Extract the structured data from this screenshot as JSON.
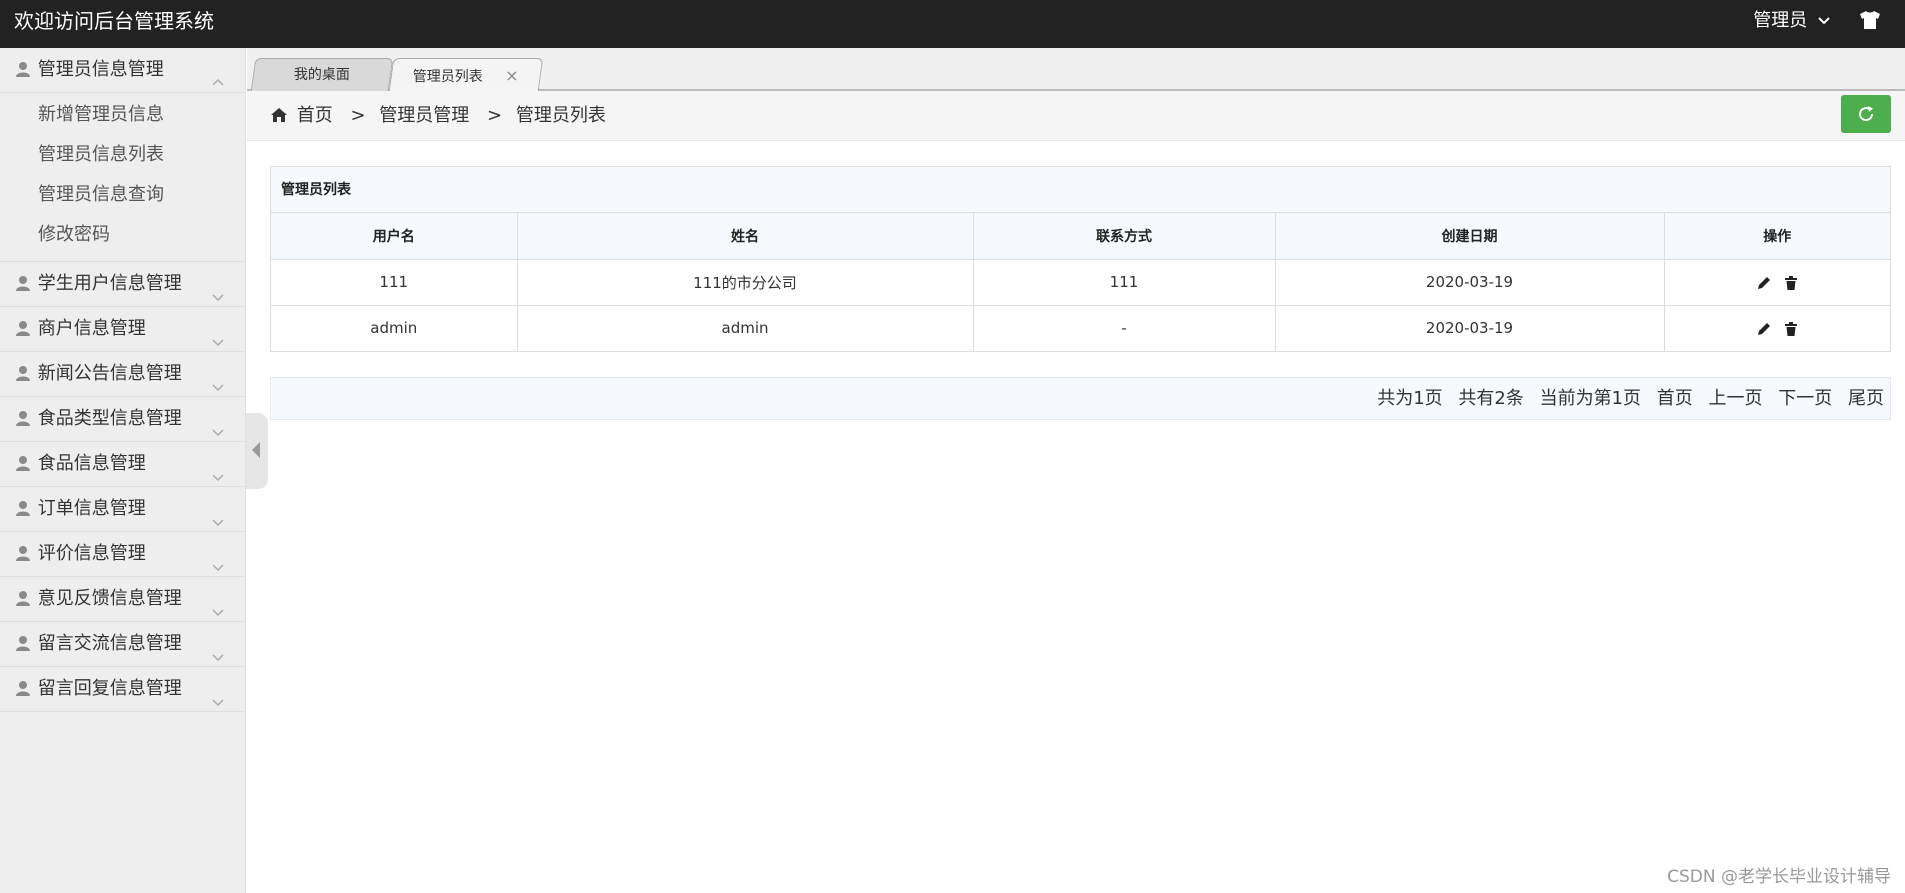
{
  "header": {
    "title": "欢迎访问后台管理系统",
    "user_label": "管理员",
    "user_menu_icon": "chevron-down-icon",
    "skin_icon": "shirt-icon"
  },
  "sidebar": {
    "groups": [
      {
        "label": "管理员信息管理",
        "expanded": true,
        "items": [
          "新增管理员信息",
          "管理员信息列表",
          "管理员信息查询",
          "修改密码"
        ]
      },
      {
        "label": "学生用户信息管理",
        "expanded": false
      },
      {
        "label": "商户信息管理",
        "expanded": false
      },
      {
        "label": "新闻公告信息管理",
        "expanded": false
      },
      {
        "label": "食品类型信息管理",
        "expanded": false
      },
      {
        "label": "食品信息管理",
        "expanded": false
      },
      {
        "label": "订单信息管理",
        "expanded": false
      },
      {
        "label": "评价信息管理",
        "expanded": false
      },
      {
        "label": "意见反馈信息管理",
        "expanded": false
      },
      {
        "label": "留言交流信息管理",
        "expanded": false
      },
      {
        "label": "留言回复信息管理",
        "expanded": false
      }
    ]
  },
  "tabs": [
    {
      "label": "我的桌面",
      "active": false
    },
    {
      "label": "管理员列表",
      "active": true,
      "close": "×"
    }
  ],
  "breadcrumb": {
    "home": "首页",
    "sep": ">",
    "level1": "管理员管理",
    "level2": "管理员列表"
  },
  "refresh_color": "#4cae4c",
  "table": {
    "title": "管理员列表",
    "columns": [
      "用户名",
      "姓名",
      "联系方式",
      "创建日期",
      "操作"
    ],
    "rows": [
      {
        "username": "111",
        "name": "111的市分公司",
        "contact": "111",
        "created": "2020-03-19"
      },
      {
        "username": "admin",
        "name": "admin",
        "contact": "-",
        "created": "2020-03-19"
      }
    ]
  },
  "pager": {
    "total_pages": "共为1页",
    "total_items": "共有2条",
    "current": "当前为第1页",
    "first": "首页",
    "prev": "上一页",
    "next": "下一页",
    "last": "尾页"
  },
  "watermark": "CSDN @老学长毕业设计辅导"
}
